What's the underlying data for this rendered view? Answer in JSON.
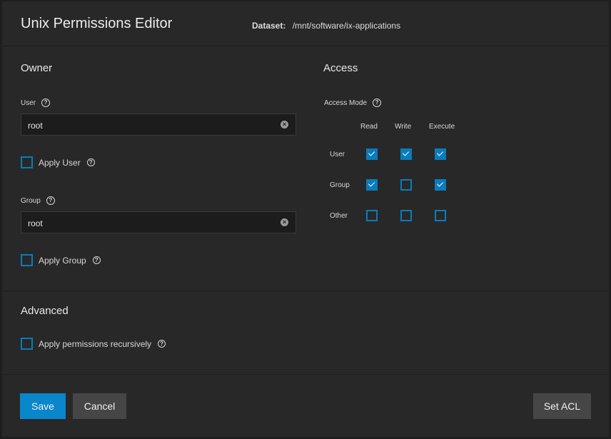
{
  "header": {
    "title": "Unix Permissions Editor",
    "dataset_label": "Dataset:",
    "dataset_path": "/mnt/software/ix-applications"
  },
  "owner": {
    "title": "Owner",
    "user_label": "User",
    "user_value": "root",
    "apply_user_label": "Apply User",
    "apply_user_checked": false,
    "group_label": "Group",
    "group_value": "root",
    "apply_group_label": "Apply Group",
    "apply_group_checked": false
  },
  "access": {
    "title": "Access",
    "mode_label": "Access Mode",
    "columns": [
      "Read",
      "Write",
      "Execute"
    ],
    "rows": [
      {
        "label": "User",
        "values": [
          true,
          true,
          true
        ]
      },
      {
        "label": "Group",
        "values": [
          true,
          false,
          true
        ]
      },
      {
        "label": "Other",
        "values": [
          false,
          false,
          false
        ]
      }
    ]
  },
  "advanced": {
    "title": "Advanced",
    "recursive_label": "Apply permissions recursively",
    "recursive_checked": false
  },
  "actions": {
    "save_label": "Save",
    "cancel_label": "Cancel",
    "set_acl_label": "Set ACL"
  },
  "colors": {
    "accent": "#0a86cb",
    "checkbox": "#0a7cbc",
    "background": "#282828"
  },
  "icons": {
    "help": "help-circle-icon",
    "clear": "clear-circle-icon",
    "check": "check-icon"
  }
}
